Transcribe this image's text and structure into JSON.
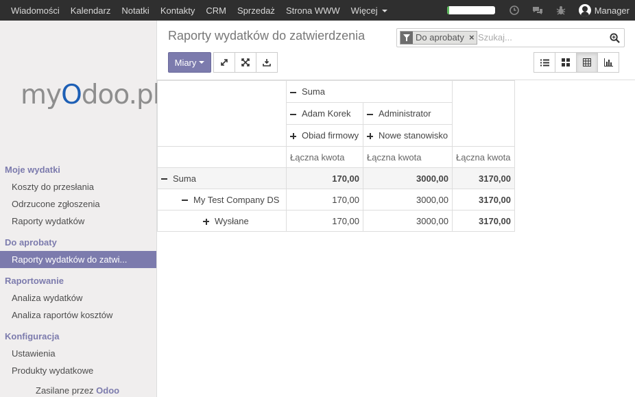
{
  "topbar": {
    "menu": [
      "Wiadomości",
      "Kalendarz",
      "Notatki",
      "Kontakty",
      "CRM",
      "Sprzedaż",
      "Strona WWW",
      "Więcej"
    ],
    "progress": 0.05,
    "user": "Manager",
    "icons": [
      "clock-icon",
      "chat-icon",
      "bug-icon"
    ]
  },
  "sidebar": {
    "logo": {
      "pre": "my",
      "o": "O",
      "post": "doo.pl"
    },
    "sections": [
      {
        "header": "Moje wydatki",
        "items": [
          "Koszty do przesłania",
          "Odrzucone zgłoszenia",
          "Raporty wydatków"
        ]
      },
      {
        "header": "Do aprobaty",
        "items": [
          "Raporty wydatków do zatwi..."
        ]
      },
      {
        "header": "Raportowanie",
        "items": [
          "Analiza wydatków",
          "Analiza raportów kosztów"
        ]
      },
      {
        "header": "Konfiguracja",
        "items": [
          "Ustawienia",
          "Produkty wydatkowe"
        ]
      }
    ],
    "active_item": "Raporty wydatków do zatwi...",
    "powered_by": "Zasilane przez",
    "powered_brand": "Odoo"
  },
  "header": {
    "title": "Raporty wydatków do zatwierdzenia",
    "measures_label": "Miary",
    "search": {
      "facet": "Do aprobaty",
      "placeholder": "Szukaj..."
    }
  },
  "pivot": {
    "col_root": "Suma",
    "col_level1": [
      "Adam Korek",
      "Administrator"
    ],
    "col_level2": [
      "Obiad firmowy",
      "Nowe stanowisko"
    ],
    "measure": "Łączna kwota",
    "rows": [
      {
        "label": "Suma",
        "values": [
          "170,00",
          "3000,00",
          "3170,00"
        ]
      },
      {
        "label": "My Test Company DS",
        "values": [
          "170,00",
          "3000,00",
          "3170,00"
        ]
      },
      {
        "label": "Wysłane",
        "values": [
          "170,00",
          "3000,00",
          "3170,00"
        ]
      }
    ]
  },
  "colors": {
    "accent": "#7c7bad",
    "navbar": "#2f2f2f",
    "progress": "#5cb85c"
  }
}
